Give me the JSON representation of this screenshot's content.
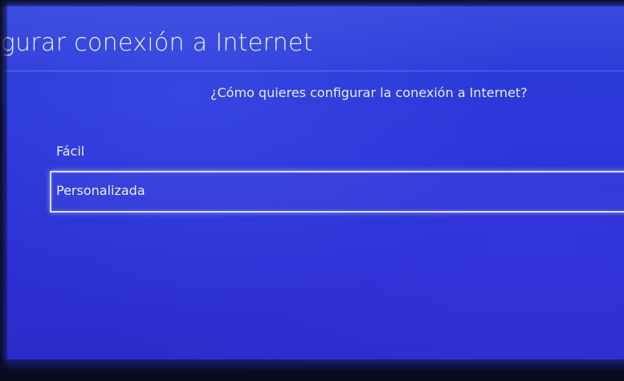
{
  "header": {
    "title": "nfigurar conexión a Internet"
  },
  "prompt": {
    "question": "¿Cómo quieres configurar la conexión a Internet?"
  },
  "options": [
    {
      "label": "Fácil",
      "selected": false
    },
    {
      "label": "Personalizada",
      "selected": true
    }
  ],
  "colors": {
    "background": "#2b35d6",
    "focus_border": "#d8deff",
    "text": "#eef1ff"
  }
}
